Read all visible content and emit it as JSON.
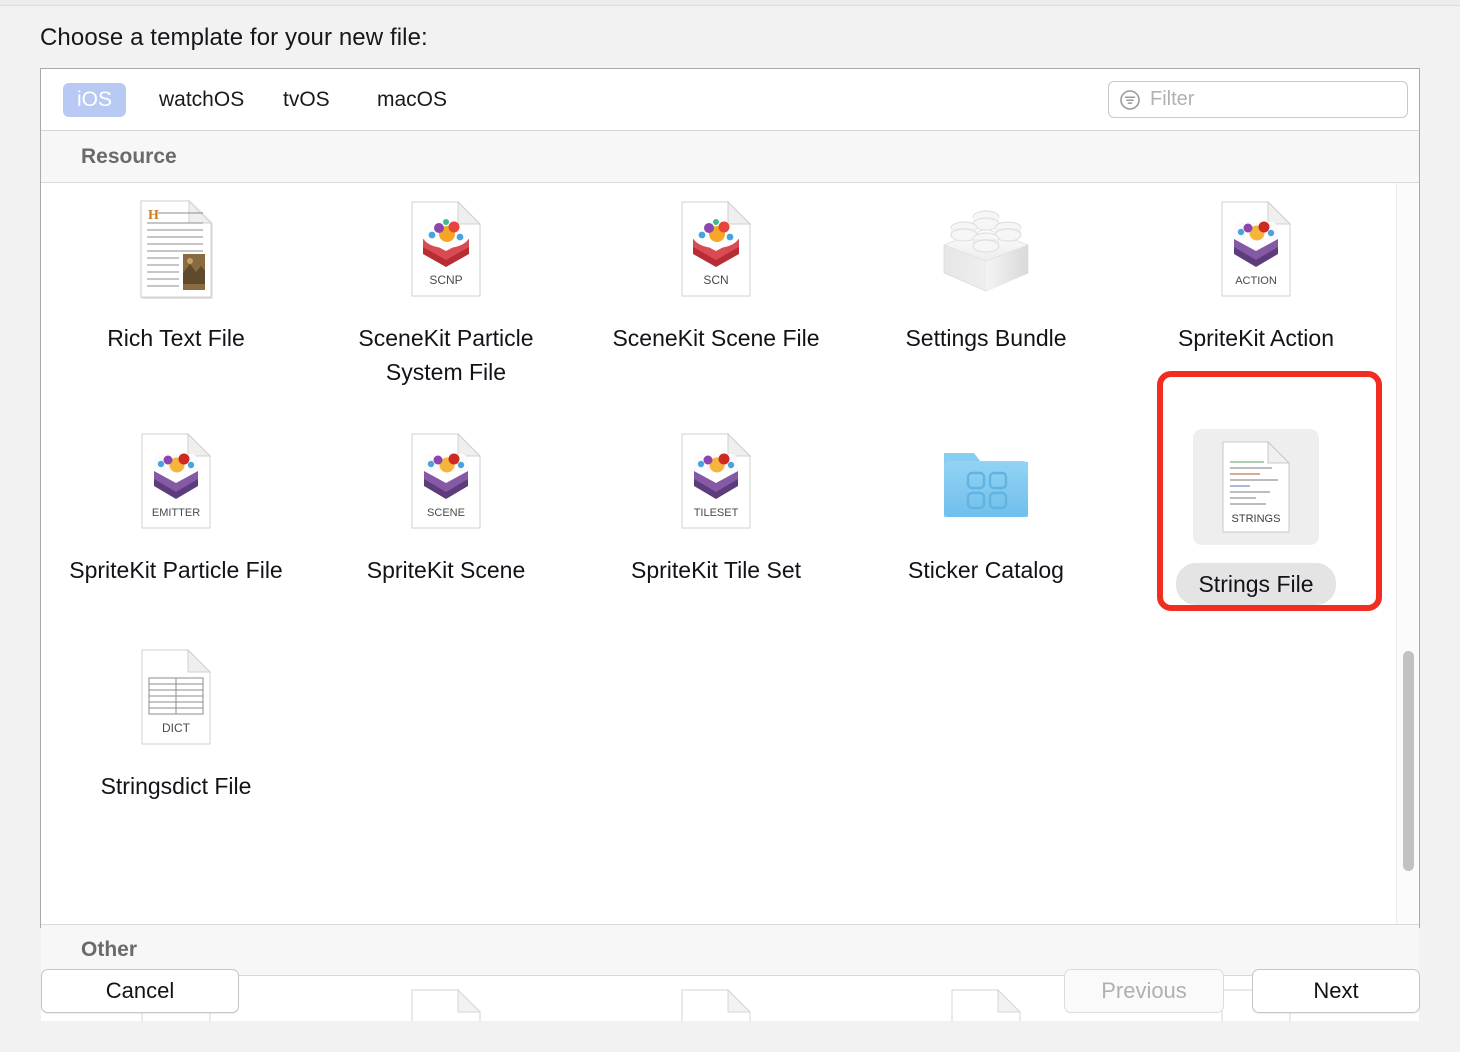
{
  "window": {
    "title": "Choose a template for your new file:"
  },
  "tabs": [
    {
      "label": "iOS",
      "active": true
    },
    {
      "label": "watchOS",
      "active": false
    },
    {
      "label": "tvOS",
      "active": false
    },
    {
      "label": "macOS",
      "active": false
    }
  ],
  "filter": {
    "placeholder": "Filter",
    "value": "",
    "icon": "filter-icon"
  },
  "sections": [
    {
      "name": "Resource"
    },
    {
      "name": "Other"
    }
  ],
  "templates": [
    {
      "label": "Rich Text File",
      "icon": "rich-text-file-icon",
      "badge": "",
      "selected": false
    },
    {
      "label": "SceneKit Particle System File",
      "icon": "scenekit-particle-icon",
      "badge": "SCNP",
      "selected": false
    },
    {
      "label": "SceneKit Scene File",
      "icon": "scenekit-scene-icon",
      "badge": "SCN",
      "selected": false
    },
    {
      "label": "Settings Bundle",
      "icon": "settings-bundle-icon",
      "badge": "",
      "selected": false
    },
    {
      "label": "SpriteKit Action",
      "icon": "spritekit-action-icon",
      "badge": "ACTION",
      "selected": false
    },
    {
      "label": "SpriteKit Particle File",
      "icon": "spritekit-emitter-icon",
      "badge": "EMITTER",
      "selected": false
    },
    {
      "label": "SpriteKit Scene",
      "icon": "spritekit-scene-icon",
      "badge": "SCENE",
      "selected": false
    },
    {
      "label": "SpriteKit Tile Set",
      "icon": "spritekit-tileset-icon",
      "badge": "TILESET",
      "selected": false
    },
    {
      "label": "Sticker Catalog",
      "icon": "sticker-catalog-icon",
      "badge": "",
      "selected": false
    },
    {
      "label": "Strings File",
      "icon": "strings-file-icon",
      "badge": "STRINGS",
      "selected": true
    },
    {
      "label": "Stringsdict File",
      "icon": "stringsdict-file-icon",
      "badge": "DICT",
      "selected": false
    }
  ],
  "buttons": {
    "cancel": "Cancel",
    "previous": "Previous",
    "next": "Next",
    "previous_disabled": true
  },
  "colors": {
    "selection_highlight": "#ef2d21",
    "active_tab_background": "#b8c9f4",
    "panel_background": "#ffffff",
    "window_background": "#f2f2f2",
    "sticker_catalog_folder": "#7ec8f2",
    "scenekit_accent": "#c9303a",
    "spritekit_accent": "#7b4f9e"
  },
  "scroll": {
    "thumb_position": "middle"
  }
}
